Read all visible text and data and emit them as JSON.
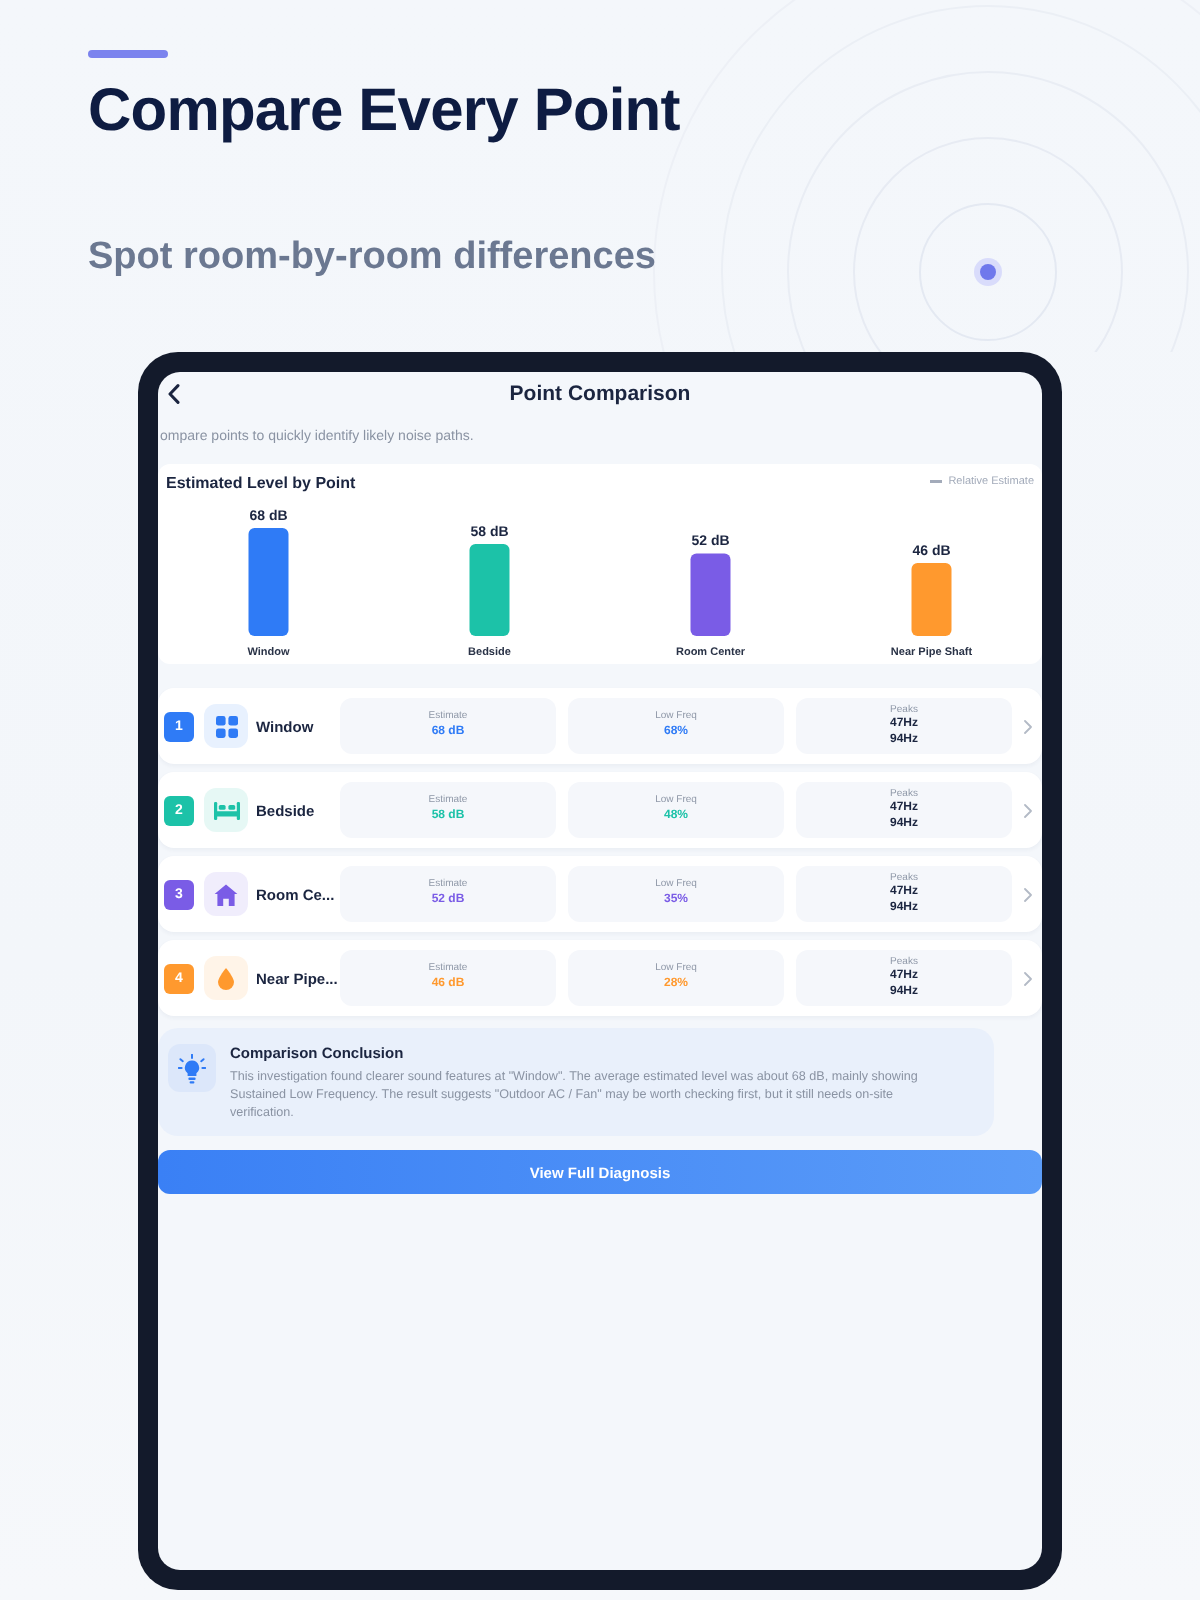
{
  "hero": {
    "title": "Compare Every Point",
    "subtitle": "Spot room-by-room differences"
  },
  "screen": {
    "title": "Point Comparison",
    "intro": "ompare points to quickly identify likely noise paths."
  },
  "level_chart": {
    "legend": "Relative Estimate",
    "chart_data": {
      "type": "bar",
      "title": "Estimated Level by Point",
      "categories": [
        "Window",
        "Bedside",
        "Room Center",
        "Near Pipe Shaft"
      ],
      "values": [
        68,
        58,
        52,
        46
      ],
      "value_labels": [
        "68 dB",
        "58 dB",
        "52 dB",
        "46 dB"
      ]
    }
  },
  "points": [
    {
      "number": "1",
      "name": "Window",
      "kind": "window",
      "color": "#2f7bf6",
      "estimate": {
        "label": "Estimate",
        "value": "68 dB"
      },
      "low_freq": {
        "label": "Low Freq",
        "value": "68%"
      },
      "peaks": {
        "label": "Peaks",
        "values": [
          "47Hz",
          "94Hz"
        ]
      }
    },
    {
      "number": "2",
      "name": "Bedside",
      "kind": "bed",
      "color": "#1cc2a8",
      "estimate": {
        "label": "Estimate",
        "value": "58 dB"
      },
      "low_freq": {
        "label": "Low Freq",
        "value": "48%"
      },
      "peaks": {
        "label": "Peaks",
        "values": [
          "47Hz",
          "94Hz"
        ]
      }
    },
    {
      "number": "3",
      "name": "Room Ce...",
      "kind": "home",
      "color": "#7a5ce6",
      "estimate": {
        "label": "Estimate",
        "value": "52 dB"
      },
      "low_freq": {
        "label": "Low Freq",
        "value": "35%"
      },
      "peaks": {
        "label": "Peaks",
        "values": [
          "47Hz",
          "94Hz"
        ]
      }
    },
    {
      "number": "4",
      "name": "Near Pipe...",
      "kind": "pipe",
      "color": "#ff992e",
      "estimate": {
        "label": "Estimate",
        "value": "46 dB"
      },
      "low_freq": {
        "label": "Low Freq",
        "value": "28%"
      },
      "peaks": {
        "label": "Peaks",
        "values": [
          "47Hz",
          "94Hz"
        ]
      }
    }
  ],
  "conclusion": {
    "title": "Comparison Conclusion",
    "text": "This investigation found clearer sound features at \"Window\". The average estimated level was about 68 dB, mainly showing Sustained Low Frequency. The result suggests \"Outdoor AC / Fan\" may be worth checking first, but it still needs on-site verification."
  },
  "action_button": "View Full Diagnosis"
}
